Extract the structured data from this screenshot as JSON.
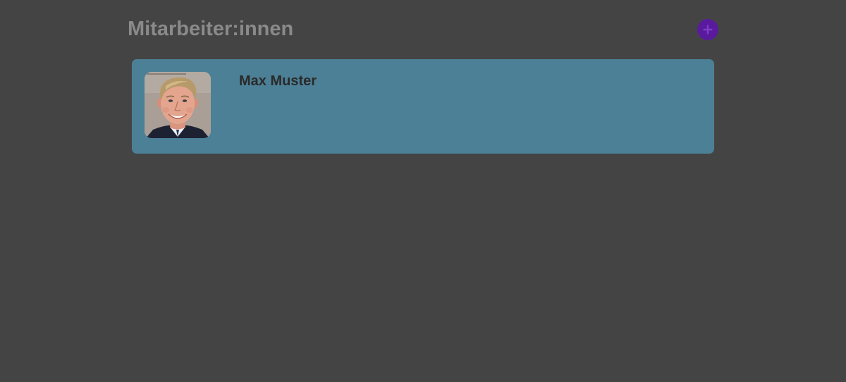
{
  "header": {
    "title": "Mitarbeiter:innen",
    "add_icon": "plus-circle-icon"
  },
  "employees": [
    {
      "name": "Max Muster",
      "avatar": "portrait-photo"
    }
  ],
  "colors": {
    "background": "#444444",
    "title": "#8a8a8a",
    "accent": "#5a1a9e",
    "card": "#4c8096",
    "name_text": "#2a2a2a"
  }
}
